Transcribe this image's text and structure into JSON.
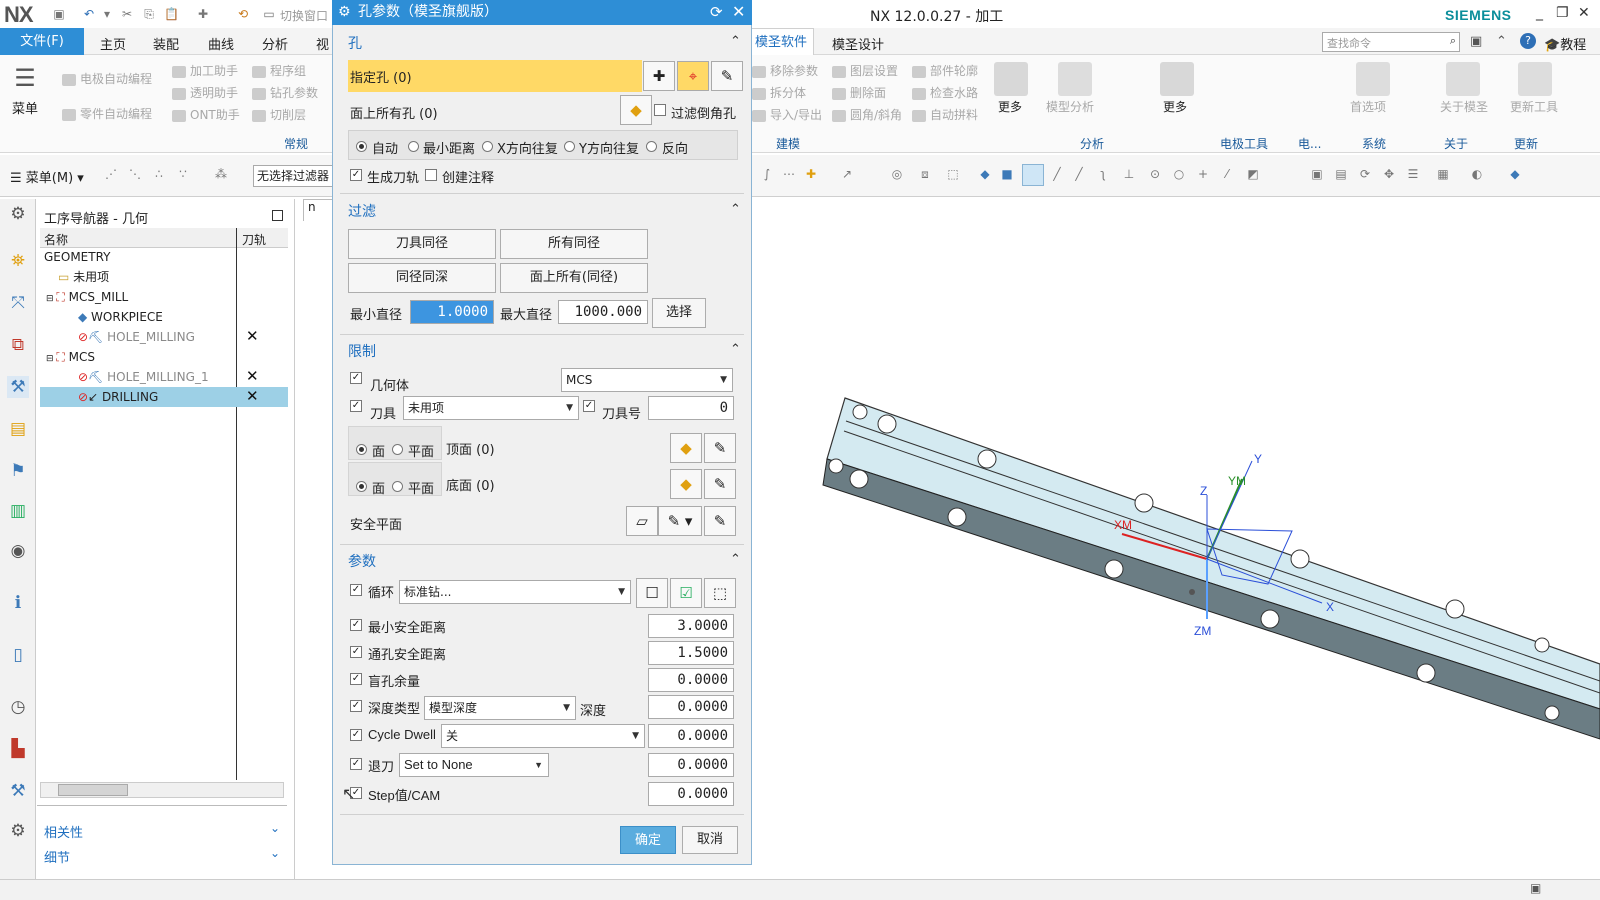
{
  "app": {
    "logo": "NX",
    "title": "NX 12.0.0.27 - 加工",
    "brand": "SIEMENS",
    "window_controls": [
      "_",
      "❐",
      "✕"
    ],
    "quick_access_item": "切换窗口"
  },
  "tabs": {
    "file": "文件(F)",
    "items": [
      "主页",
      "装配",
      "曲线",
      "分析",
      "视"
    ],
    "active": "模圣软件",
    "after": [
      "模圣设计"
    ]
  },
  "help": {
    "search_placeholder": "查找命令",
    "tutorial": "教程"
  },
  "ribbon": {
    "menu_label": "菜单",
    "left_items": [
      "电极自动编程",
      "加工助手",
      "程序组",
      "零件自动编程",
      "透明助手",
      "钻孔参数",
      "ONT助手",
      "切削层"
    ],
    "left_group": "常规",
    "mid_items": [
      "移除参数",
      "图层设置",
      "部件轮廓",
      "拆分体",
      "删除面",
      "检查水路",
      "导入/导出",
      "圆角/斜角",
      "自动拼料"
    ],
    "more1": "更多",
    "model_analysis": "模型分析",
    "more2": "更多",
    "prefs": "首选项",
    "about": "关于模圣",
    "update": "更新工具",
    "groups": [
      "建模",
      "分析",
      "电极工具",
      "电...",
      "系统",
      "关于",
      "更新"
    ]
  },
  "toolbar": {
    "menu": "菜单(M)",
    "filter": "无选择过滤器"
  },
  "navigator": {
    "title": "工序导航器 - 几何",
    "columns": [
      "名称",
      "刀轨"
    ],
    "rows": [
      {
        "name": "GEOMETRY",
        "indent": 0,
        "icon": "",
        "mark": ""
      },
      {
        "name": "未用项",
        "indent": 1,
        "icon": "folder-icon",
        "mark": ""
      },
      {
        "name": "MCS_MILL",
        "indent": 1,
        "icon": "mcs-icon",
        "mark": ""
      },
      {
        "name": "WORKPIECE",
        "indent": 2,
        "icon": "workpiece-icon",
        "mark": ""
      },
      {
        "name": "HOLE_MILLING",
        "indent": 2,
        "icon": "operation-icon",
        "mark": "✕"
      },
      {
        "name": "MCS",
        "indent": 1,
        "icon": "mcs-icon",
        "mark": ""
      },
      {
        "name": "HOLE_MILLING_1",
        "indent": 2,
        "icon": "operation-icon",
        "mark": "✕"
      },
      {
        "name": "DRILLING",
        "indent": 2,
        "icon": "drill-icon",
        "mark": "✕"
      }
    ],
    "accordions": [
      "相关性",
      "细节"
    ]
  },
  "dialog": {
    "title": "孔参数（模圣旗舰版）",
    "sec_hole": "孔",
    "specify_hole": "指定孔 (0)",
    "all_holes": "面上所有孔 (0)",
    "filter_chamfer": "过滤倒角孔",
    "radio_opts": [
      "自动",
      "最小距离",
      "X方向往复",
      "Y方向往复",
      "反向"
    ],
    "gen_path": "生成刀轨",
    "create_note": "创建注释",
    "sec_filter": "过滤",
    "btn_same_dia": "刀具同径",
    "btn_all_dia": "所有同径",
    "btn_same_depth": "同径同深",
    "btn_face_all": "面上所有(同径)",
    "min_dia_label": "最小直径",
    "min_dia": "1.0000",
    "max_dia_label": "最大直径",
    "max_dia": "1000.000",
    "select": "选择",
    "sec_limit": "限制",
    "geometry": "几何体",
    "geometry_val": "MCS",
    "tool": "刀具",
    "tool_val": "未用项",
    "tool_no": "刀具号",
    "tool_no_val": "0",
    "face": "面",
    "plane": "平面",
    "top": "顶面 (0)",
    "bottom": "底面 (0)",
    "safe_plane": "安全平面",
    "sec_params": "参数",
    "cycle": "循环",
    "cycle_val": "标准钻...",
    "min_safe": "最小安全距离",
    "min_safe_val": "3.0000",
    "thru_safe": "通孔安全距离",
    "thru_safe_val": "1.5000",
    "blind": "盲孔余量",
    "blind_val": "0.0000",
    "depth_type": "深度类型",
    "depth_type_val": "模型深度",
    "depth": "深度",
    "depth_val": "0.0000",
    "dwell": "Cycle Dwell",
    "dwell_sel": "关",
    "dwell_val": "0.0000",
    "retract": "退刀",
    "retract_sel": "Set to None",
    "retract_val": "0.0000",
    "step": "Step值/CAM",
    "step_val": "0.0000",
    "ok": "确定",
    "cancel": "取消"
  },
  "viewport": {
    "tab": "n",
    "axes": {
      "xm": "XM",
      "ym": "YM",
      "zm": "ZM",
      "x": "X",
      "y": "Y",
      "z": "Z"
    }
  },
  "colors": {
    "accent": "#2e8ed6",
    "highlight": "#ffd966",
    "part": "#d4eaf1",
    "selection": "#9dd0e6"
  }
}
